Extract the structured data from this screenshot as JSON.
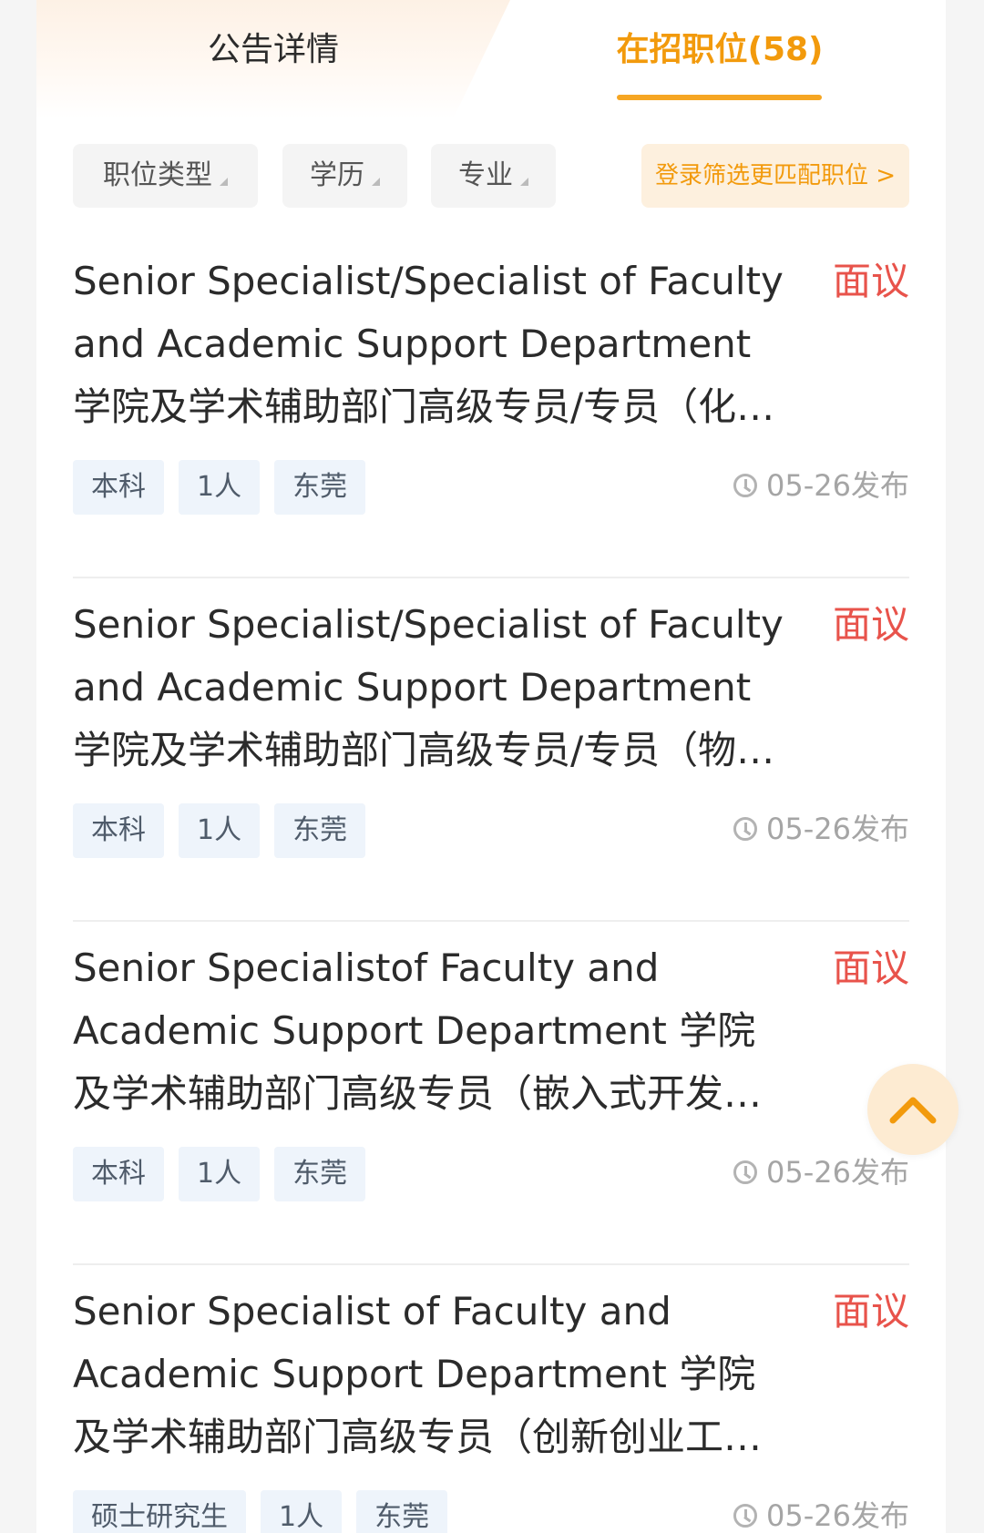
{
  "tabs": {
    "detail": "公告详情",
    "positions": "在招职位(58)"
  },
  "filters": {
    "type": "职位类型",
    "education": "学历",
    "major": "专业",
    "login_filter": "登录筛选更匹配职位 >"
  },
  "jobs": [
    {
      "title": "Senior Specialist/Specialist of Faculty and Academic Support Department 学院及学术辅助部门高级专员/专员（化学…",
      "salary": "面议",
      "tags": [
        "本科",
        "1人",
        "东莞"
      ],
      "published": "05-26发布"
    },
    {
      "title": "Senior Specialist/Specialist of Faculty and Academic Support Department 学院及学术辅助部门高级专员/专员（物理…",
      "salary": "面议",
      "tags": [
        "本科",
        "1人",
        "东莞"
      ],
      "published": "05-26发布"
    },
    {
      "title": "Senior Specialistof Faculty and Academic Support Department 学院及学术辅助部门高级专员（嵌入式开发工…",
      "salary": "面议",
      "tags": [
        "本科",
        "1人",
        "东莞"
      ],
      "published": "05-26发布"
    },
    {
      "title": "Senior Specialist of Faculty and Academic Support Department 学院及学术辅助部门高级专员（创新创业工程…",
      "salary": "面议",
      "tags": [
        "硕士研究生",
        "1人",
        "东莞"
      ],
      "published": "05-26发布"
    }
  ],
  "icons": {
    "clock": "clock-icon",
    "scroll_top": "chevron-up-icon"
  },
  "colors": {
    "accent": "#f29a0c",
    "salary": "#e8534b",
    "tag_bg": "#eef4fb"
  }
}
